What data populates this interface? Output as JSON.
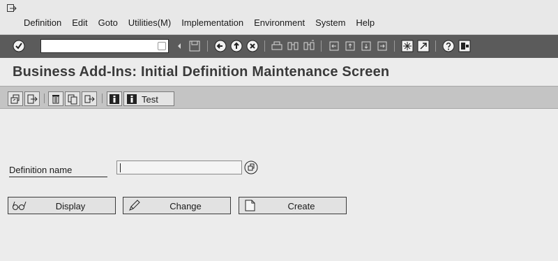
{
  "menu": {
    "items": [
      "Definition",
      "Edit",
      "Goto",
      "Utilities(M)",
      "Implementation",
      "Environment",
      "System",
      "Help"
    ]
  },
  "standard_toolbar": {
    "command_field_value": "",
    "icons": [
      "enter-icon",
      "save-icon",
      "back-icon",
      "exit-icon",
      "cancel-icon",
      "print-icon",
      "find-icon",
      "find-next-icon",
      "first-page-icon",
      "prev-page-icon",
      "next-page-icon",
      "last-page-icon",
      "create-session-icon",
      "shortcut-icon",
      "help-icon",
      "layout-menu-icon"
    ]
  },
  "title": "Business Add-Ins: Initial Definition Maintenance Screen",
  "app_toolbar": {
    "icons": [
      "other-object-icon",
      "where-used-icon",
      "delete-icon",
      "copy-icon",
      "rename-icon",
      "info-icon",
      "documentation-icon"
    ],
    "test_label": "Test"
  },
  "form": {
    "definition_label": "Definition name",
    "definition_value": ""
  },
  "buttons": {
    "display": "Display",
    "change": "Change",
    "create": "Create"
  }
}
